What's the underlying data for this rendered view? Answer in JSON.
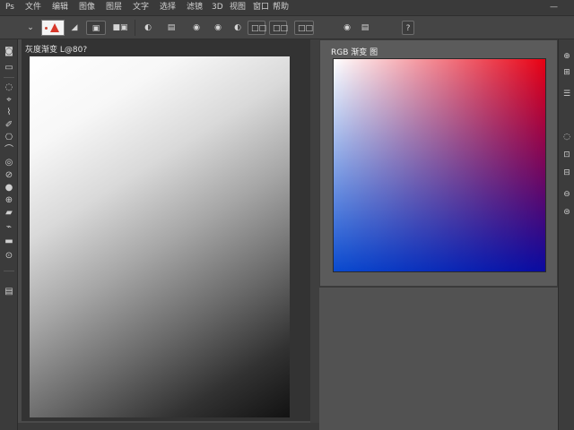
{
  "menu": [
    "Ps",
    "文件",
    "编辑",
    "图像",
    "图层",
    "文字",
    "选择",
    "滤镜",
    "3D",
    "视图",
    "窗口",
    "帮助"
  ],
  "window_controls": "—",
  "options_bar": {
    "items": [
      "⌄",
      "◢",
      "▣",
      "■▣",
      "◐",
      "▤",
      "◉",
      "◉",
      "◐",
      "□□",
      "□□",
      "□□",
      "◉",
      "▤",
      "?"
    ]
  },
  "tools": [
    "◙",
    "▭",
    "◌",
    "⌖",
    "⌇",
    "✐",
    "⎔",
    "⌒",
    "◎",
    "⊘",
    "●",
    "⊕",
    "▰",
    "⌁",
    "▬",
    "⊙",
    "▤"
  ],
  "left_document": {
    "title": "灰度渐变 L@80?"
  },
  "right_document": {
    "title": "RGB 渐变 图"
  },
  "right_strip": [
    "⊕",
    "⊞",
    "☰",
    "◌",
    "⊡",
    "⊟",
    "⊖",
    "⊜"
  ],
  "colors": {
    "gradient_red": "#e80012",
    "gradient_blue": "#0a0aa0",
    "gradient_light_blue": "#0a4bd0"
  }
}
